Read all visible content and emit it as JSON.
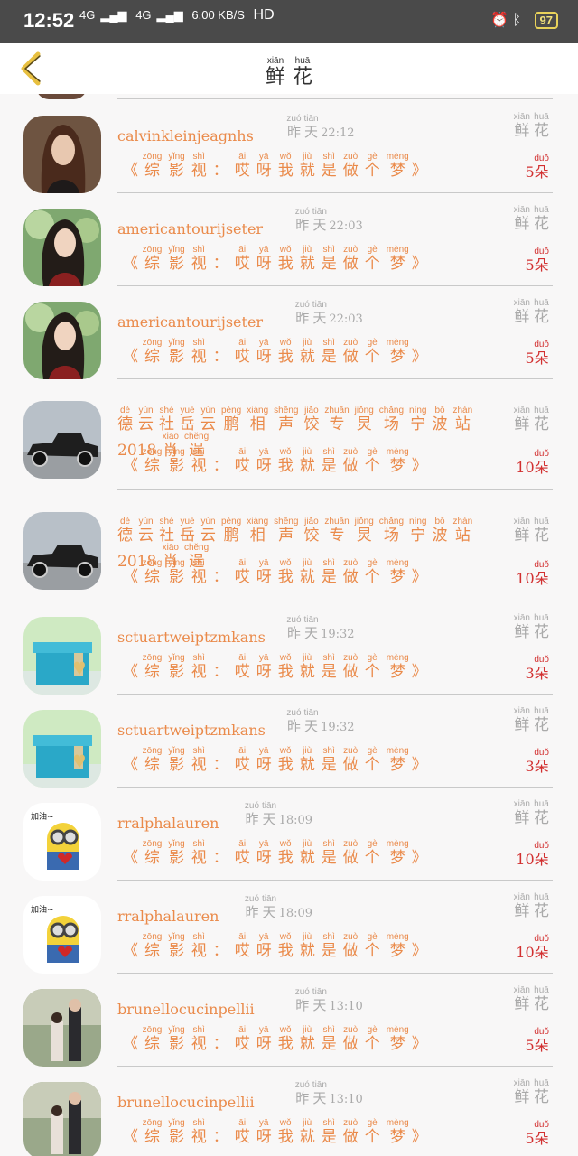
{
  "status_bar": {
    "time": "12:52",
    "net1": "4G",
    "net2": "4G",
    "speed": "6.00 KB/S",
    "hd": "HD",
    "battery": "97"
  },
  "header": {
    "title": [
      {
        "h": "鲜",
        "p": "xiān"
      },
      {
        "h": "花",
        "p": "huā"
      }
    ]
  },
  "labels": {
    "yesterday": [
      {
        "h": "昨",
        "p": "zuó"
      },
      {
        "h": "天",
        "p": "tiān"
      }
    ],
    "flowers": [
      {
        "h": "鲜",
        "p": "xiān"
      },
      {
        "h": "花",
        "p": "huā"
      }
    ],
    "story": [
      {
        "h": "《",
        "p": ""
      },
      {
        "h": "综",
        "p": "zōng"
      },
      {
        "h": "影",
        "p": "yǐng"
      },
      {
        "h": "视",
        "p": "shì"
      },
      {
        "h": "：",
        "p": ""
      },
      {
        "h": "哎",
        "p": "āi"
      },
      {
        "h": "呀",
        "p": "yā"
      },
      {
        "h": "我",
        "p": "wǒ"
      },
      {
        "h": "就",
        "p": "jiù"
      },
      {
        "h": "是",
        "p": "shì"
      },
      {
        "h": "做",
        "p": "zuò"
      },
      {
        "h": "个",
        "p": "gè"
      },
      {
        "h": "梦",
        "p": "mèng"
      },
      {
        "h": "》",
        "p": ""
      }
    ],
    "unit": {
      "h": "朵",
      "p": "duǒ"
    },
    "long_name": [
      {
        "h": "德",
        "p": "dé"
      },
      {
        "h": "云",
        "p": "yún"
      },
      {
        "h": "社",
        "p": "shè"
      },
      {
        "h": "岳",
        "p": "yuè"
      },
      {
        "h": "云",
        "p": "yún"
      },
      {
        "h": "鹏",
        "p": "péng"
      },
      {
        "h": "相",
        "p": "xiàng"
      },
      {
        "h": "声",
        "p": "shēng"
      },
      {
        "h": "饺",
        "p": "jiǎo"
      },
      {
        "h": "专",
        "p": "zhuān"
      },
      {
        "h": "炅",
        "p": "jiǒng"
      },
      {
        "h": "场",
        "p": "chǎng"
      },
      {
        "h": "宁",
        "p": "níng"
      },
      {
        "h": "波",
        "p": "bō"
      },
      {
        "h": "站",
        "p": "zhàn"
      },
      {
        "h": "2018",
        "p": ""
      },
      {
        "h": "肖",
        "p": "xiāo"
      },
      {
        "h": "逞",
        "p": "chěng"
      }
    ]
  },
  "items": [
    {
      "name": "calvinkleinjeagnhs",
      "time": "22:12",
      "count": "5",
      "avatar": "girl-brown"
    },
    {
      "name": "americantourijseter",
      "time": "22:03",
      "count": "5",
      "avatar": "girl-green"
    },
    {
      "name": "americantourijseter",
      "time": "22:03",
      "count": "5",
      "avatar": "girl-green"
    },
    {
      "name": "",
      "time": "",
      "count": "10",
      "avatar": "car",
      "long": true
    },
    {
      "name": "",
      "time": "",
      "count": "10",
      "avatar": "car",
      "long": true
    },
    {
      "name": "sctuartweiptzmkans",
      "time": "19:32",
      "count": "3",
      "avatar": "giftbox"
    },
    {
      "name": "sctuartweiptzmkans",
      "time": "19:32",
      "count": "3",
      "avatar": "giftbox"
    },
    {
      "name": "rralphalauren",
      "time": "18:09",
      "count": "10",
      "avatar": "minion"
    },
    {
      "name": "rralphalauren",
      "time": "18:09",
      "count": "10",
      "avatar": "minion"
    },
    {
      "name": "brunellocucinpellii",
      "time": "13:10",
      "count": "5",
      "avatar": "couple"
    },
    {
      "name": "brunellocucinpellii",
      "time": "13:10",
      "count": "5",
      "avatar": "couple"
    }
  ]
}
